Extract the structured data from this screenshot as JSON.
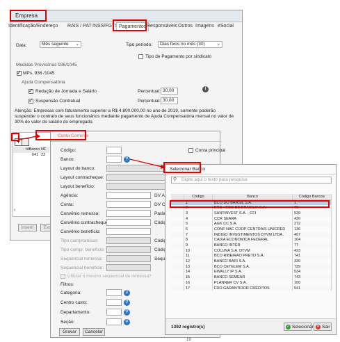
{
  "empresa": {
    "title": "Empresa",
    "tabs": [
      "Identificação/Endereço",
      "RAIS / PAT",
      "INSS/FGTS",
      "Pagamentos",
      "Responsáveis",
      "Outros",
      "Imagens",
      "eSocial"
    ],
    "data_label": "Data:",
    "data_value": "Mês seguinte",
    "tipo_periodo_label": "Tipo período:",
    "tipo_periodo_value": "Dias fixos no mês (30)",
    "tipo_pagamento_sindicato": "Tipo de Pagamento por sindicato",
    "medidas_title": "Medidas Provisórias 936/1045",
    "mps_label": "MPs. 936 /1045",
    "ajuda_title": "Ajuda Compensatória",
    "reducao_label": "Redução de Jornada e Salário",
    "suspensao_label": "Suspensão Contratual",
    "percentual_label": "Percentual:",
    "percentual_1": "30,00",
    "percentual_2": "30,00",
    "atencao": "Atenção: Empresas com faturamento superior a R$ 4.800.000,00 no ano de 2019, somente poderão suspender o contrato de seus funcionários mediante pagamento de Ajuda Compensatória mensal no valor de 30% do valor do salário do empregado.",
    "grid_headers": [
      "IdBanco",
      "NF"
    ],
    "grid_row": [
      "641",
      "23"
    ],
    "inserir": "Inserir",
    "excluir": "Exc",
    "page_number": "19"
  },
  "conta": {
    "title": "Conta Corrente",
    "codigo": "Código:",
    "banco": "Banco:",
    "conta_principal": "Conta principal",
    "layout_banco": "Layout do banco:",
    "layout_contracheque": "Layout contracheque:",
    "layout_beneficio": "Layout benefício:",
    "agencia": "Agência:",
    "dv_ag": "DV Ag",
    "conta": "Conta:",
    "dv_co": "DV Co",
    "convenio_remessa": "Convênio remessa:",
    "param": "Parâm",
    "convenio_contracheque": "Convênio contracheque:",
    "codigo2": "Códig",
    "convenio_beneficio": "Convênio benefício:",
    "tipo_compromisso": "Tipo compromisso:",
    "tipo_compr_beneficio": "Tipo compr. benefício:",
    "sequencial_remessa": "Sequencial remessa:",
    "seque": "Seque",
    "sequencial_beneficio": "Sequencial benefício:",
    "utilizar": "Utilizar o mesmo sequencial de remessa?",
    "filtros": "Filtros:",
    "categoria": "Categoria:",
    "centro_custo": "Centro custo:",
    "departamento": "Departamento:",
    "secao": "Seção:",
    "gravar": "Gravar",
    "cancelar": "Cancelar"
  },
  "selecionar": {
    "title": "Selecionar Banco",
    "search_placeholder": "Digite aqui o texto para pesquisa",
    "headers": [
      "Código",
      "Banco",
      "Código Bancos"
    ],
    "rows": [
      [
        "1",
        "BCO DO BRASIL S.A.",
        "1"
      ],
      [
        "2",
        "BRB - BCO DE BRASILIA S.A.",
        "70"
      ],
      [
        "3",
        "SANTINVEST S.A. - CFI",
        "539"
      ],
      [
        "4",
        "CCR SEARA",
        "430"
      ],
      [
        "5",
        "AGK CC S.A.",
        "272"
      ],
      [
        "6",
        "CONF NAC COOP CENTRAIS UNICRED",
        "136"
      ],
      [
        "7",
        "INDIGO INVESTIMENTOS DTVM LTDA.",
        "407"
      ],
      [
        "8",
        "CAIXA ECONOMICA FEDERAL",
        "104"
      ],
      [
        "9",
        "BANCO INTER",
        "77"
      ],
      [
        "10",
        "COLUNA S.A. DTVM",
        "423"
      ],
      [
        "11",
        "BCO RIBEIRAO PRETO S.A.",
        "741"
      ],
      [
        "12",
        "BANCO BARI S.A.",
        "330"
      ],
      [
        "13",
        "BCO CETELEM S.A.",
        "739"
      ],
      [
        "14",
        "EWALLY IP S.A.",
        "534"
      ],
      [
        "15",
        "BANCO SEMEAR",
        "743"
      ],
      [
        "16",
        "PLANNER CV S.A.",
        "100"
      ],
      [
        "17",
        "FDO GARANTIDOR CRÉDITOS",
        "541"
      ]
    ],
    "registros": "1392 registro(s)",
    "selecionar_btn": "Selecionar",
    "sair_btn": "Sair"
  }
}
